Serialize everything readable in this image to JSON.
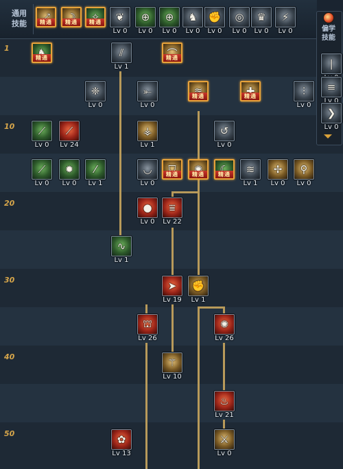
{
  "common_skills_label": "通用\n技能",
  "side_panel": {
    "label": "偏学\n技能"
  },
  "mastered_text": "精通",
  "level_markers": [
    "1",
    "10",
    "20",
    "30",
    "40",
    "50"
  ],
  "common_skills": [
    {
      "glyph": "⤢",
      "color": "gold",
      "mastered": true
    },
    {
      "glyph": "☽",
      "color": "gold",
      "mastered": true
    },
    {
      "glyph": "✧",
      "color": "green",
      "mastered": true
    },
    {
      "glyph": "❦",
      "color": "dark",
      "level": "Lv 0"
    },
    {
      "glyph": "⊕",
      "color": "green",
      "level": "Lv 0"
    },
    {
      "glyph": "⊕",
      "color": "green",
      "level": "Lv 0"
    },
    {
      "glyph": "♞",
      "color": "dark",
      "level": "Lv 0"
    },
    {
      "glyph": "✊",
      "color": "dark",
      "level": "Lv 0"
    },
    {
      "glyph": "◎",
      "color": "dark",
      "level": "Lv 0"
    },
    {
      "glyph": "♛",
      "color": "dark",
      "level": "Lv 0"
    },
    {
      "glyph": "⚡",
      "color": "dark",
      "level": "Lv 0"
    }
  ],
  "side_skills": [
    {
      "glyph": "❘",
      "color": "dark",
      "level": "Lv 0"
    },
    {
      "glyph": "≡",
      "color": "dark",
      "level": "Lv 0"
    },
    {
      "glyph": "❯",
      "color": "dark",
      "level": "Lv 0"
    }
  ],
  "tree_skills": [
    {
      "glyph": "♞",
      "color": "green",
      "mastered": true
    },
    {
      "glyph": "⫽",
      "color": "dark",
      "level": "Lv 1"
    },
    {
      "glyph": "⌒",
      "color": "gold",
      "mastered": true
    },
    {
      "glyph": "❈",
      "color": "dark",
      "level": "Lv 0"
    },
    {
      "glyph": "⤜",
      "color": "dark",
      "level": "Lv 0"
    },
    {
      "glyph": "≋",
      "color": "gold",
      "mastered": true
    },
    {
      "glyph": "✚",
      "color": "gold",
      "mastered": true
    },
    {
      "glyph": "⫶",
      "color": "dark",
      "level": "Lv 0"
    },
    {
      "glyph": "⟋",
      "color": "green",
      "level": "Lv 0"
    },
    {
      "glyph": "⟋",
      "color": "red",
      "level": "Lv 24"
    },
    {
      "glyph": "⚶",
      "color": "gold",
      "level": "Lv 1"
    },
    {
      "glyph": "↺",
      "color": "dark",
      "level": "Lv 0"
    },
    {
      "glyph": "⟋",
      "color": "green",
      "level": "Lv 0"
    },
    {
      "glyph": "✹",
      "color": "green",
      "level": "Lv 0"
    },
    {
      "glyph": "⁄",
      "color": "green",
      "level": "Lv 1"
    },
    {
      "glyph": "◡",
      "color": "dark",
      "level": "Lv 0"
    },
    {
      "glyph": "⛉",
      "color": "gold",
      "mastered": true
    },
    {
      "glyph": "✺",
      "color": "gold",
      "mastered": true
    },
    {
      "glyph": "☾",
      "color": "green",
      "mastered": true
    },
    {
      "glyph": "≋",
      "color": "dark",
      "level": "Lv 1"
    },
    {
      "glyph": "✢",
      "color": "gold",
      "level": "Lv 0"
    },
    {
      "glyph": "⚲",
      "color": "gold",
      "level": "Lv 0"
    },
    {
      "glyph": "●",
      "color": "red",
      "level": "Lv 0"
    },
    {
      "glyph": "⩸",
      "color": "red",
      "level": "Lv 22"
    },
    {
      "glyph": "∿",
      "color": "green",
      "level": "Lv 1"
    },
    {
      "glyph": "➤",
      "color": "red",
      "level": "Lv 19"
    },
    {
      "glyph": "✊",
      "color": "gold",
      "level": "Lv 1"
    },
    {
      "glyph": "⛫",
      "color": "red",
      "level": "Lv 26"
    },
    {
      "glyph": "✺",
      "color": "red",
      "level": "Lv 26"
    },
    {
      "glyph": "⚚",
      "color": "gold",
      "level": "Lv 10"
    },
    {
      "glyph": "♨",
      "color": "red",
      "level": "Lv 21"
    },
    {
      "glyph": "✿",
      "color": "red",
      "level": "Lv 13"
    },
    {
      "glyph": "⚔",
      "color": "gold",
      "level": "Lv 0"
    }
  ]
}
